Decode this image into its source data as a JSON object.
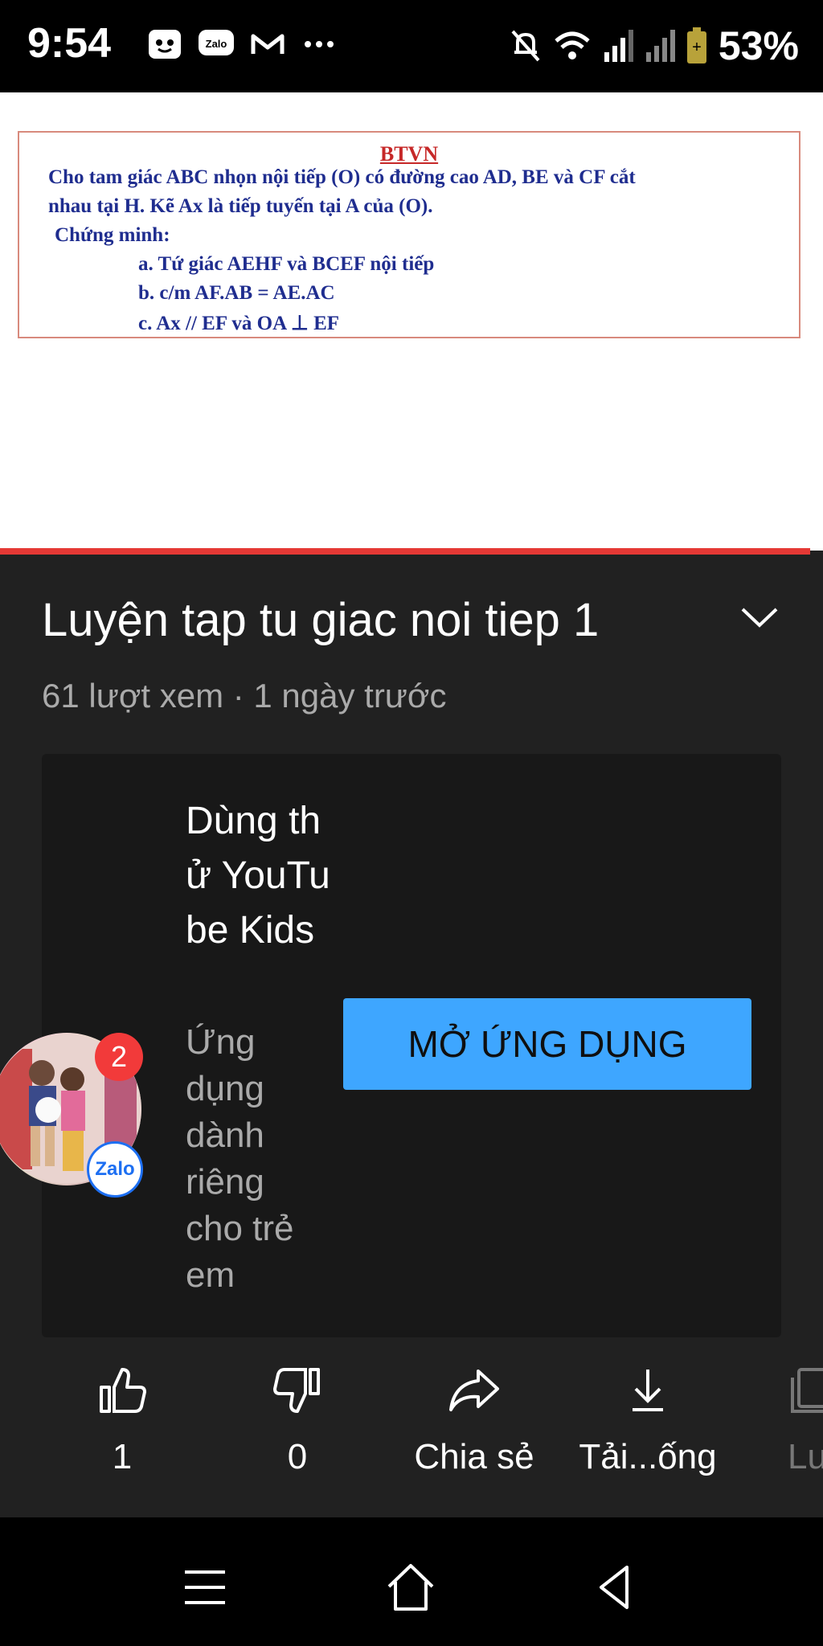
{
  "status_bar": {
    "time": "9:54",
    "left_icons": [
      "messenger-icon",
      "zalo-icon",
      "gmail-icon",
      "more-dots-icon"
    ],
    "right_icons": [
      "mute-bell-icon",
      "wifi-icon",
      "signal-icon",
      "signal-icon-2",
      "battery-icon"
    ],
    "battery": "53%"
  },
  "slide": {
    "title": "BTVN",
    "line1": "Cho tam giác ABC nhọn nội tiếp (O) có đường cao AD, BE và CF cắt",
    "line2": "nhau tại H. Kẽ Ax là tiếp tuyến tại A của (O).",
    "line3": "Chứng minh:",
    "item_a": "a. Tứ giác AEHF và BCEF nội tiếp",
    "item_b": "b. c/m  AF.AB = AE.AC",
    "item_c": "c. Ax // EF và OA ⊥ EF"
  },
  "video": {
    "title": "Luyện tap tu giac noi tiep 1",
    "meta": "61 lượt xem · 1 ngày trước"
  },
  "promo": {
    "title": "Dùng thử YouTube Kids",
    "description": "Ứng dụng dành riêng cho trẻ em",
    "button_label": "MỞ ỨNG DỤNG"
  },
  "chat_bubble": {
    "badge_count": "2",
    "app_label": "Zalo"
  },
  "actions": {
    "like_count": "1",
    "dislike_count": "0",
    "share_label": "Chia sẻ",
    "download_label": "Tải...ống",
    "save_label": "Lu"
  },
  "colors": {
    "accent_red": "#e53935",
    "button_blue": "#3ea6ff",
    "background": "#212121"
  }
}
